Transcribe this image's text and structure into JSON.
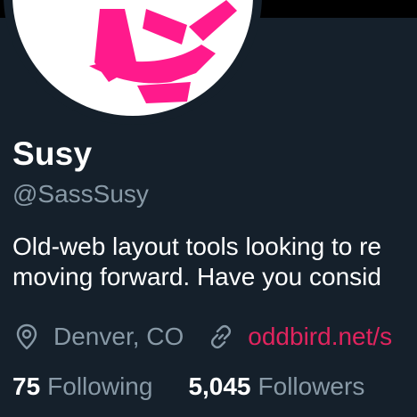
{
  "profile": {
    "display_name": "Susy",
    "handle": "@SassSusy",
    "bio_lines": [
      "Old-web layout tools looking to re",
      "moving forward. Have you consid"
    ],
    "location": "Denver, CO",
    "website": "oddbird.net/s",
    "avatar_icon": "susy-logo",
    "accent_color": "#e0245e",
    "logo_color": "#ff1a8c"
  },
  "stats": {
    "following_count": "75",
    "following_label": "Following",
    "followers_count": "5,045",
    "followers_label": "Followers"
  }
}
